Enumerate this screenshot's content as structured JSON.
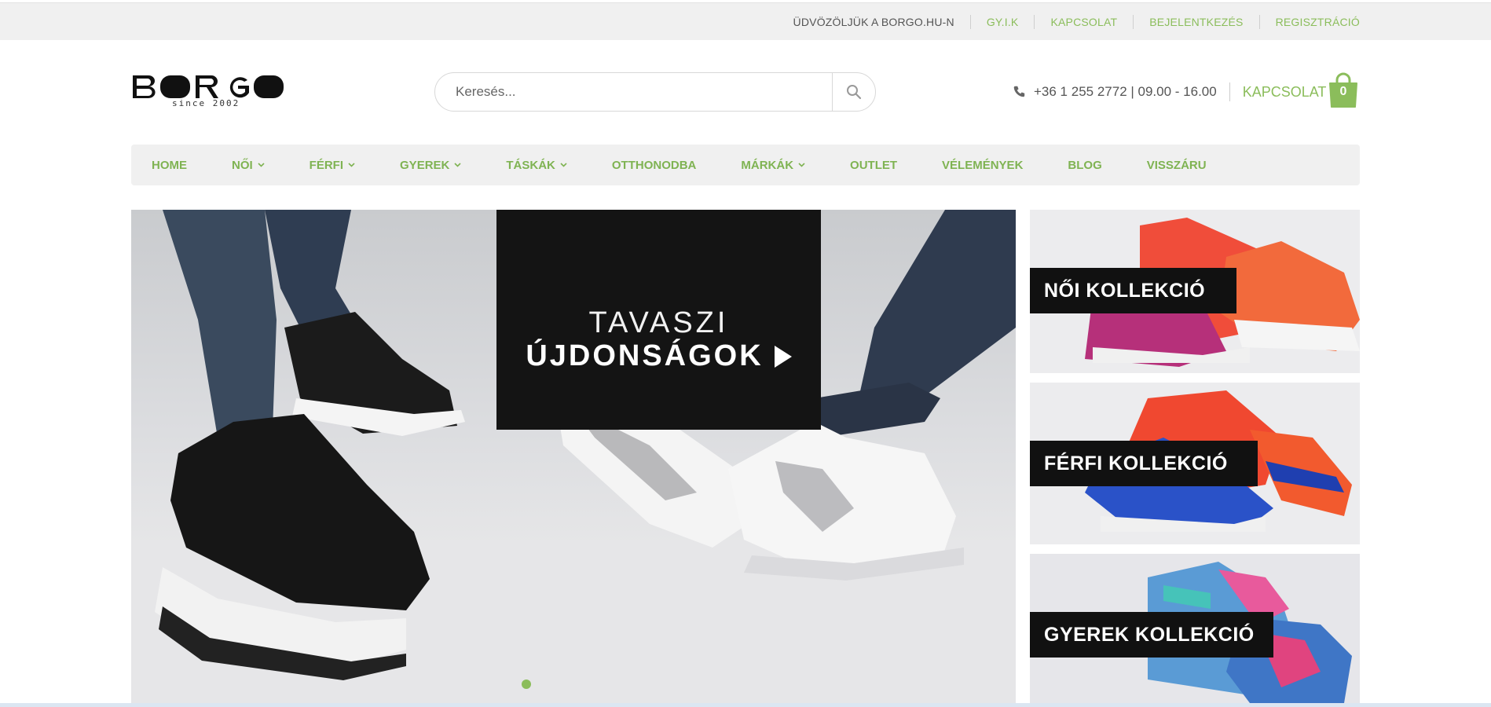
{
  "topbar": {
    "welcome": "ÜDVÖZÖLJÜK A BORGO.HU-N",
    "links": [
      "GY.I.K",
      "KAPCSOLAT",
      "BEJELENTKEZÉS",
      "REGISZTRÁCIÓ"
    ]
  },
  "header": {
    "logo_text": "BORGO",
    "logo_sub": "since 2002",
    "search_placeholder": "Keresés...",
    "phone": "+36 1 255 2772 | 09.00 - 16.00",
    "contact_label": "KAPCSOLAT",
    "cart_count": "0"
  },
  "nav": {
    "items": [
      {
        "label": "HOME",
        "dropdown": false
      },
      {
        "label": "NŐI",
        "dropdown": true
      },
      {
        "label": "FÉRFI",
        "dropdown": true
      },
      {
        "label": "GYEREK",
        "dropdown": true
      },
      {
        "label": "TÁSKÁK",
        "dropdown": true
      },
      {
        "label": "OTTHONODBA",
        "dropdown": false
      },
      {
        "label": "MÁRKÁK",
        "dropdown": true
      },
      {
        "label": "OUTLET",
        "dropdown": false
      },
      {
        "label": "VÉLEMÉNYEK",
        "dropdown": false
      },
      {
        "label": "BLOG",
        "dropdown": false
      },
      {
        "label": "VISSZÁRU",
        "dropdown": false
      }
    ]
  },
  "hero": {
    "line1": "TAVASZI",
    "line2": "ÚJDONSÁGOK"
  },
  "collections": [
    {
      "label": "NŐI KOLLEKCIÓ"
    },
    {
      "label": "FÉRFI KOLLEKCIÓ"
    },
    {
      "label": "GYEREK KOLLEKCIÓ"
    }
  ],
  "colors": {
    "accent": "#8bbd5b",
    "nav_text": "#7fb352",
    "topbar_bg": "#f0f0f0",
    "dark_box": "#141414"
  }
}
